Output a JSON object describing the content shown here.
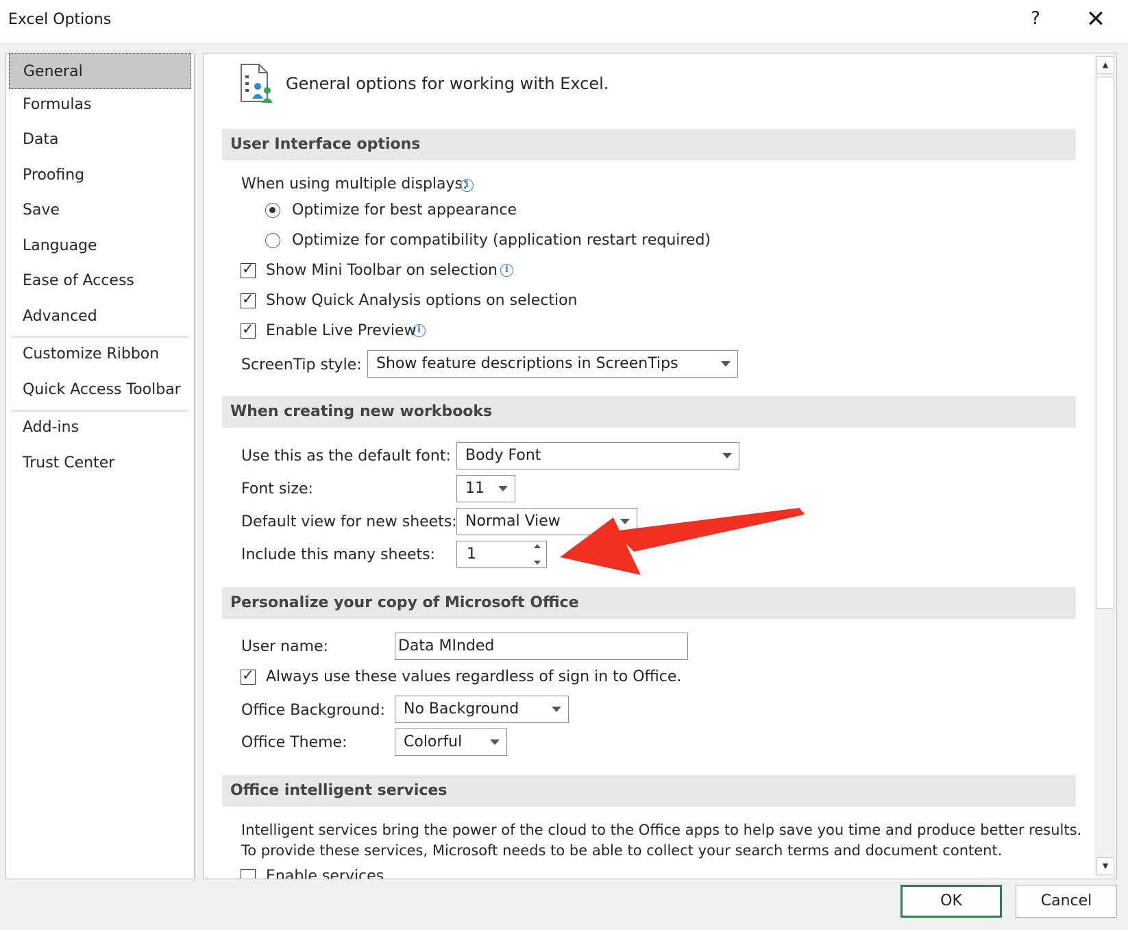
{
  "window": {
    "title": "Excel Options",
    "help_label": "?",
    "close_label": "✕"
  },
  "sidebar": {
    "items": [
      {
        "label": "General"
      },
      {
        "label": "Formulas"
      },
      {
        "label": "Data"
      },
      {
        "label": "Proofing"
      },
      {
        "label": "Save"
      },
      {
        "label": "Language"
      },
      {
        "label": "Ease of Access"
      },
      {
        "label": "Advanced"
      },
      {
        "label": "Customize Ribbon"
      },
      {
        "label": "Quick Access Toolbar"
      },
      {
        "label": "Add-ins"
      },
      {
        "label": "Trust Center"
      }
    ],
    "selected": "General"
  },
  "header": {
    "text": "General options for working with Excel."
  },
  "ui_options": {
    "heading": "User Interface options",
    "multi_display_label": "When using multiple displays:",
    "radio_best": "Optimize for best appearance",
    "radio_compat": "Optimize for compatibility (application restart required)",
    "mini_toolbar": "Show Mini Toolbar on selection",
    "quick_analysis": "Show Quick Analysis options on selection",
    "live_preview": "Enable Live Preview",
    "screentip_label": "ScreenTip style:",
    "screentip_value": "Show feature descriptions in ScreenTips"
  },
  "new_workbooks": {
    "heading": "When creating new workbooks",
    "font_label": "Use this as the default font:",
    "font_value": "Body Font",
    "size_label": "Font size:",
    "size_value": "11",
    "view_label": "Default view for new sheets:",
    "view_value": "Normal View",
    "sheets_label": "Include this many sheets:",
    "sheets_value": "1"
  },
  "personalize": {
    "heading": "Personalize your copy of Microsoft Office",
    "username_label": "User name:",
    "username_value": "Data MInded",
    "always_use": "Always use these values regardless of sign in to Office.",
    "background_label": "Office Background:",
    "background_value": "No Background",
    "theme_label": "Office Theme:",
    "theme_value": "Colorful"
  },
  "intelligent": {
    "heading": "Office intelligent services",
    "line1": "Intelligent services bring the power of the cloud to the Office apps to help save you time and produce better results.",
    "line2": "To provide these services, Microsoft needs to be able to collect your search terms and document content.",
    "enable": "Enable services"
  },
  "buttons": {
    "ok": "OK",
    "cancel": "Cancel"
  },
  "colors": {
    "annotation_arrow": "#f03020",
    "ok_border": "#2e7d4f",
    "info_icon": "#2a7dd6"
  }
}
